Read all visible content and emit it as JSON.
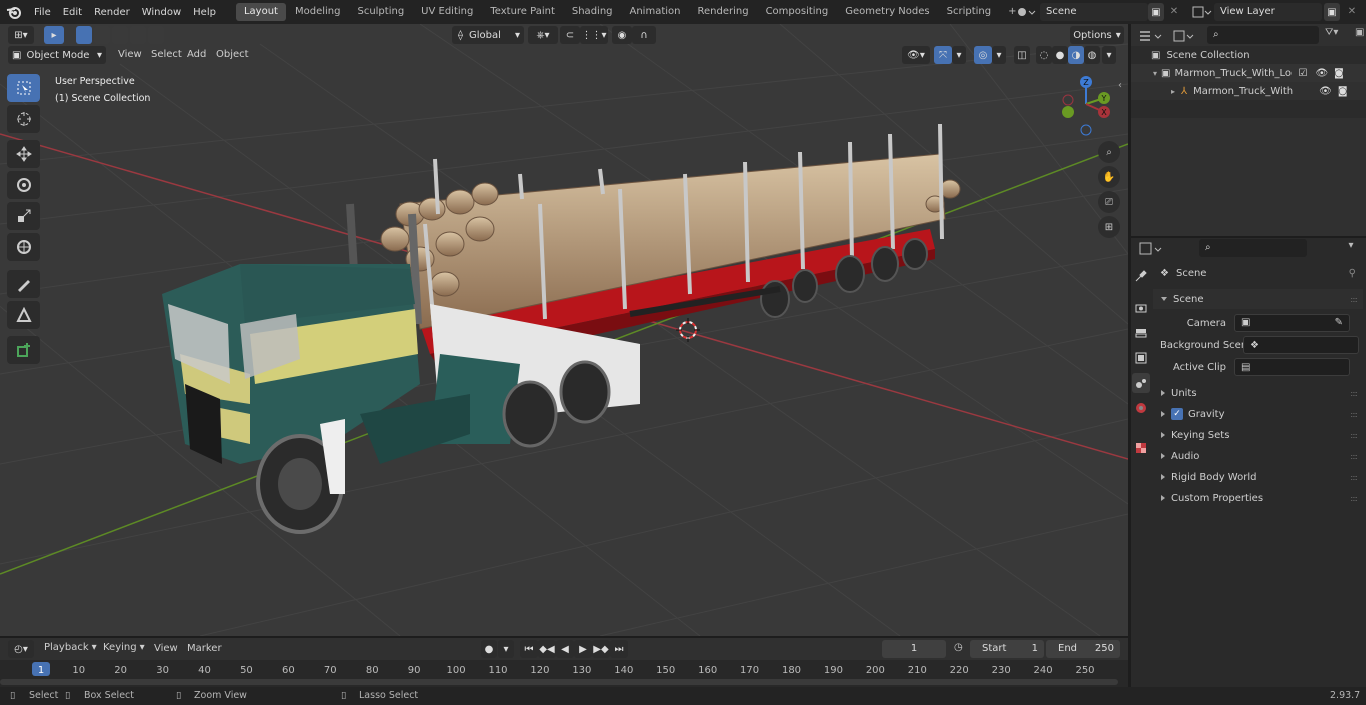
{
  "menu": {
    "items": [
      "File",
      "Edit",
      "Render",
      "Window",
      "Help"
    ]
  },
  "workspaces": {
    "tabs": [
      "Layout",
      "Modeling",
      "Sculpting",
      "UV Editing",
      "Texture Paint",
      "Shading",
      "Animation",
      "Rendering",
      "Compositing",
      "Geometry Nodes",
      "Scripting"
    ],
    "active": "Layout",
    "add": "+"
  },
  "scene_selector": {
    "value": "Scene"
  },
  "view_layer_selector": {
    "value": "View Layer"
  },
  "viewport_header": {
    "mode": "Object Mode",
    "menus": [
      "View",
      "Select",
      "Add",
      "Object"
    ],
    "orientation": "Global",
    "options": "Options"
  },
  "viewport_overlay": {
    "line1": "User Perspective",
    "line2": "(1) Scene Collection"
  },
  "gizmo": {
    "x": "X",
    "y": "Y",
    "z": "Z"
  },
  "outliner": {
    "root": "Scene Collection",
    "items": [
      {
        "label": "Marmon_Truck_With_Logging"
      },
      {
        "label": "Marmon_Truck_With_Log"
      }
    ]
  },
  "properties": {
    "header_label": "Scene",
    "section": "Scene",
    "fields": {
      "camera_label": "Camera",
      "background_label": "Background Scene",
      "clip_label": "Active Clip"
    },
    "subpanels": [
      "Units",
      "Gravity",
      "Keying Sets",
      "Audio",
      "Rigid Body World",
      "Custom Properties"
    ],
    "gravity_checked": true
  },
  "timeline": {
    "menus": [
      "Playback",
      "Keying",
      "View",
      "Marker"
    ],
    "current_frame": "1",
    "start_label": "Start",
    "start_value": "1",
    "end_label": "End",
    "end_value": "250",
    "ruler": [
      "1",
      "10",
      "20",
      "30",
      "40",
      "50",
      "60",
      "70",
      "80",
      "90",
      "100",
      "110",
      "120",
      "130",
      "140",
      "150",
      "160",
      "170",
      "180",
      "190",
      "200",
      "210",
      "220",
      "230",
      "240",
      "250"
    ]
  },
  "statusbar": {
    "select": "Select",
    "box_select": "Box Select",
    "zoom_view": "Zoom View",
    "lasso_select": "Lasso Select",
    "version": "2.93.7"
  },
  "colors": {
    "accent": "#4772b3",
    "x_axis": "#a8333a",
    "y_axis": "#6a9a23",
    "z_axis": "#3d7bd6",
    "truck_cab": "#1f4a48",
    "trailer": "#c4161c"
  }
}
